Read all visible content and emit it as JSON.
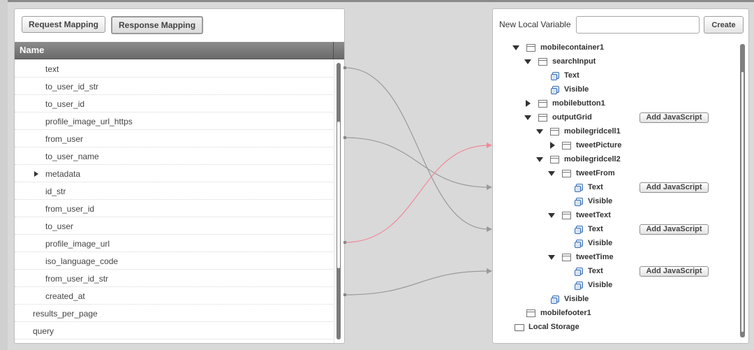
{
  "tabs": {
    "request_label": "Request Mapping",
    "response_label": "Response Mapping"
  },
  "grid": {
    "header": "Name",
    "rows": [
      {
        "label": "text"
      },
      {
        "label": "to_user_id_str"
      },
      {
        "label": "to_user_id"
      },
      {
        "label": "profile_image_url_https"
      },
      {
        "label": "from_user"
      },
      {
        "label": "to_user_name"
      },
      {
        "label": "metadata"
      },
      {
        "label": "id_str"
      },
      {
        "label": "from_user_id"
      },
      {
        "label": "to_user"
      },
      {
        "label": "profile_image_url"
      },
      {
        "label": "iso_language_code"
      },
      {
        "label": "from_user_id_str"
      },
      {
        "label": "created_at"
      },
      {
        "label": "results_per_page"
      },
      {
        "label": "query"
      }
    ]
  },
  "right": {
    "new_var_label": "New Local Variable",
    "new_var_value": "",
    "create_label": "Create",
    "tree": [
      {
        "label": "mobilecontainer1",
        "icon": "container-icon"
      },
      {
        "label": "searchInput",
        "icon": "container-icon"
      },
      {
        "label": "Text",
        "icon": "property-icon"
      },
      {
        "label": "Visible",
        "icon": "property-icon"
      },
      {
        "label": "mobilebutton1",
        "icon": "container-icon"
      },
      {
        "label": "outputGrid",
        "icon": "container-icon",
        "js": "Add JavaScript"
      },
      {
        "label": "mobilegridcell1",
        "icon": "container-icon"
      },
      {
        "label": "tweetPicture",
        "icon": "container-icon"
      },
      {
        "label": "mobilegridcell2",
        "icon": "container-icon"
      },
      {
        "label": "tweetFrom",
        "icon": "container-icon"
      },
      {
        "label": "Text",
        "icon": "property-icon",
        "js": "Add JavaScript"
      },
      {
        "label": "Visible",
        "icon": "property-icon"
      },
      {
        "label": "tweetText",
        "icon": "container-icon"
      },
      {
        "label": "Text",
        "icon": "property-icon",
        "js": "Add JavaScript"
      },
      {
        "label": "Visible",
        "icon": "property-icon"
      },
      {
        "label": "tweetTime",
        "icon": "container-icon"
      },
      {
        "label": "Text",
        "icon": "property-icon",
        "js": "Add JavaScript"
      },
      {
        "label": "Visible",
        "icon": "property-icon"
      },
      {
        "label": "Visible",
        "icon": "property-icon"
      },
      {
        "label": "mobilefooter1",
        "icon": "container-icon"
      },
      {
        "label": "Local Storage",
        "icon": "folder-icon"
      }
    ]
  },
  "colors": {
    "connector": "#999999",
    "connector_highlight": "#f08a9a"
  }
}
